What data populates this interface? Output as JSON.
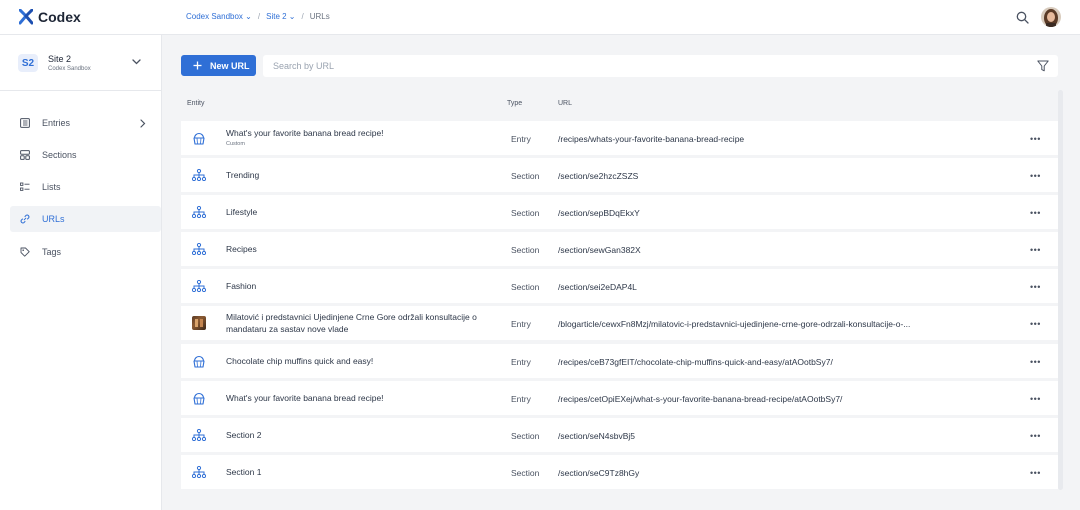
{
  "app": {
    "name": "Codex"
  },
  "breadcrumb": [
    {
      "label": "Codex Sandbox",
      "has_menu": true
    },
    {
      "label": "Site 2",
      "has_menu": true
    },
    {
      "label": "URLs",
      "has_menu": false
    }
  ],
  "site_switcher": {
    "badge": "S2",
    "name": "Site 2",
    "subtitle": "Codex Sandbox"
  },
  "nav": [
    {
      "label": "Entries",
      "icon": "entries-icon",
      "expandable": true,
      "active": false
    },
    {
      "label": "Sections",
      "icon": "sections-icon",
      "expandable": false,
      "active": false
    },
    {
      "label": "Lists",
      "icon": "lists-icon",
      "expandable": false,
      "active": false
    },
    {
      "label": "URLs",
      "icon": "link-icon",
      "expandable": false,
      "active": true
    },
    {
      "label": "Tags",
      "icon": "tag-icon",
      "expandable": false,
      "active": false
    }
  ],
  "toolbar": {
    "new_label": "New URL",
    "search_placeholder": "Search by URL",
    "search_value": ""
  },
  "table": {
    "columns": [
      "Entity",
      "Type",
      "URL"
    ],
    "rows": [
      {
        "icon": "recipe-icon",
        "entity": "What's your favorite banana bread recipe!",
        "sub": "Custom",
        "type": "Entry",
        "url": "/recipes/whats-your-favorite-banana-bread-recipe"
      },
      {
        "icon": "section-icon",
        "entity": "Trending",
        "sub": "",
        "type": "Section",
        "url": "/section/se2hzcZSZS"
      },
      {
        "icon": "section-icon",
        "entity": "Lifestyle",
        "sub": "",
        "type": "Section",
        "url": "/section/sepBDqEkxY"
      },
      {
        "icon": "section-icon",
        "entity": "Recipes",
        "sub": "",
        "type": "Section",
        "url": "/section/sewGan382X"
      },
      {
        "icon": "section-icon",
        "entity": "Fashion",
        "sub": "",
        "type": "Section",
        "url": "/section/sei2eDAP4L"
      },
      {
        "icon": "thumbnail",
        "entity": "Milatović i predstavnici Ujedinjene Crne Gore održali konsultacije o mandataru za sastav nove vlade",
        "sub": "",
        "type": "Entry",
        "url": "/blogarticle/cewxFn8Mzj/milatovic-i-predstavnici-ujedinjene-crne-gore-odrzali-konsultacije-o-..."
      },
      {
        "icon": "recipe-icon",
        "entity": "Chocolate chip muffins quick and easy!",
        "sub": "",
        "type": "Entry",
        "url": "/recipes/ceB73gfEIT/chocolate-chip-muffins-quick-and-easy/atAOotbSy7/"
      },
      {
        "icon": "recipe-icon",
        "entity": "What's your favorite banana bread recipe!",
        "sub": "",
        "type": "Entry",
        "url": "/recipes/cetOpiEXej/what-s-your-favorite-banana-bread-recipe/atAOotbSy7/"
      },
      {
        "icon": "section-icon",
        "entity": "Section 2",
        "sub": "",
        "type": "Section",
        "url": "/section/seN4sbvBj5"
      },
      {
        "icon": "section-icon",
        "entity": "Section 1",
        "sub": "",
        "type": "Section",
        "url": "/section/seC9Tz8hGy"
      }
    ],
    "row_action": "•••"
  },
  "colors": {
    "accent": "#2f6fd6",
    "background": "#f3f4f6",
    "surface": "#ffffff"
  }
}
